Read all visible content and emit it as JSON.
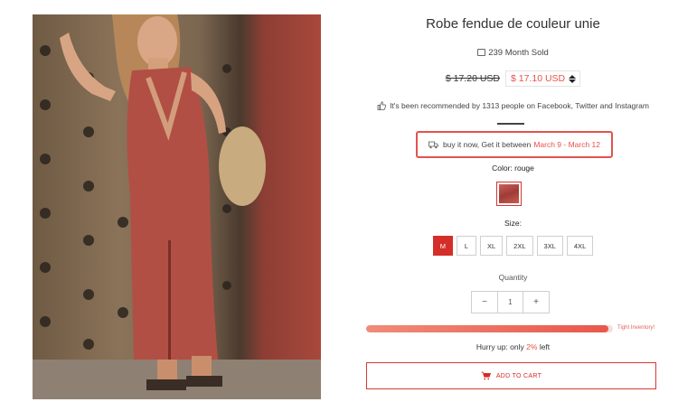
{
  "product": {
    "title": "Robe fendue de couleur unie",
    "sold_text": "239 Month Sold",
    "old_price": "$ 17.20 USD",
    "new_price": "$ 17.10 USD",
    "recommendation": "It's been recommended by 1313 people on Facebook, Twitter and Instagram"
  },
  "shipping": {
    "prefix": "buy it now, Get it between",
    "dates": "March 9 - March 12"
  },
  "color": {
    "label": "Color: rouge"
  },
  "size": {
    "label": "Size:",
    "options": [
      "M",
      "L",
      "XL",
      "2XL",
      "3XL",
      "4XL"
    ],
    "selected": "M"
  },
  "quantity": {
    "label": "Quantity",
    "value": "1",
    "minus": "−",
    "plus": "+"
  },
  "stock": {
    "note": "Tight Inventory!",
    "fill_percent": 98,
    "hurry_prefix": "Hurry up: only",
    "percent": "2%",
    "hurry_suffix": "left"
  },
  "cart": {
    "label": "ADD TO CART"
  },
  "colors": {
    "accent": "#e8524a",
    "highlight_border": "#e2534d",
    "selected_size": "#d42e28"
  },
  "icons": [
    "calendar-icon",
    "price-sort-icon",
    "thumbs-up-icon",
    "truck-icon",
    "cart-icon"
  ]
}
